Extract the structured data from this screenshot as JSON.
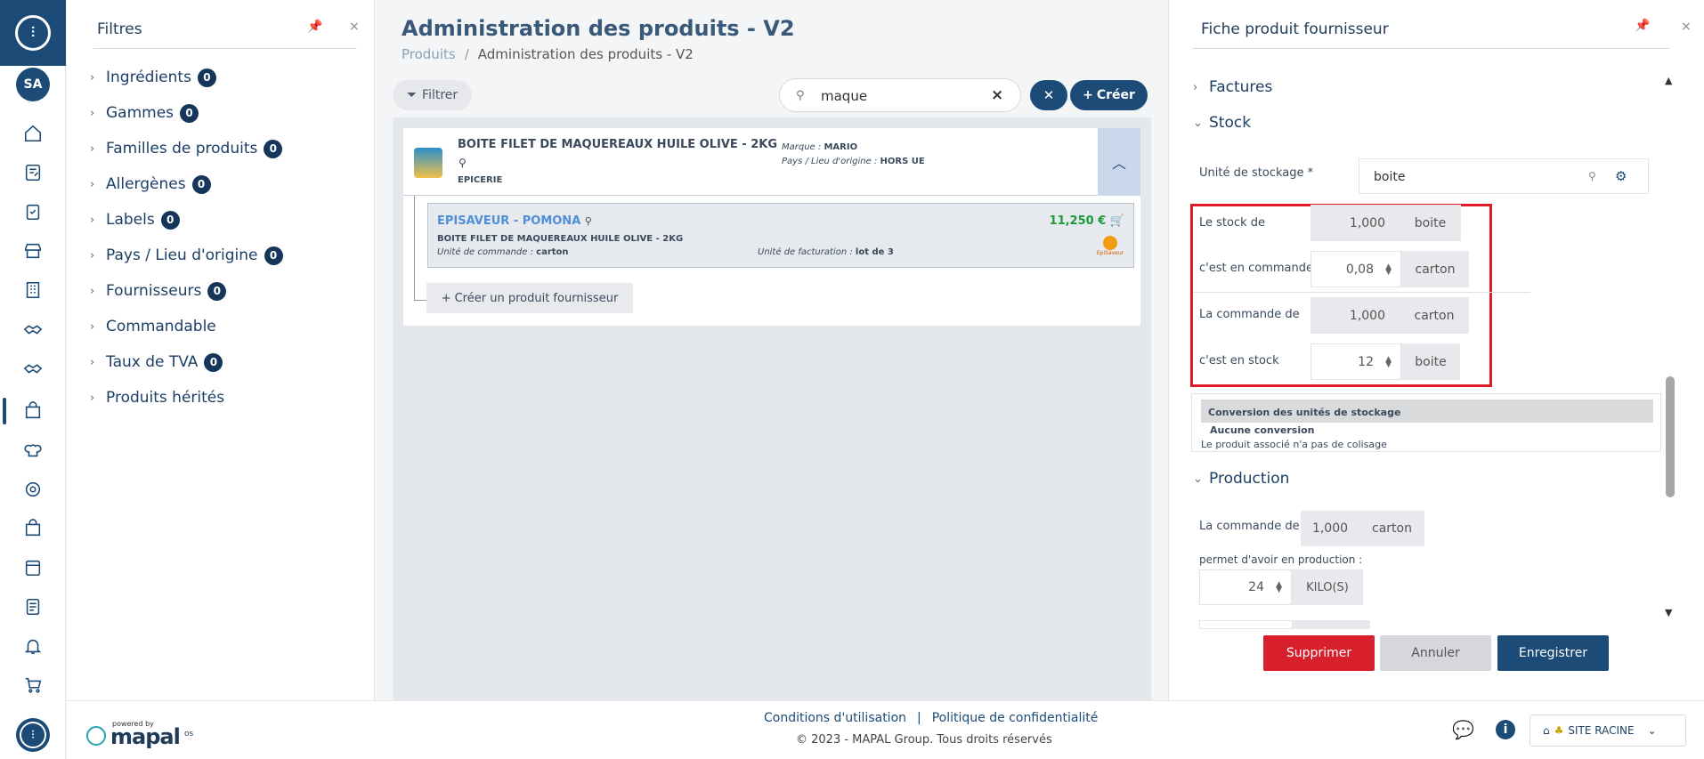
{
  "rail": {
    "avatar": "SA"
  },
  "filters": {
    "title": "Filtres",
    "items": [
      {
        "label": "Ingrédients",
        "count": "0"
      },
      {
        "label": "Gammes",
        "count": "0"
      },
      {
        "label": "Familles de produits",
        "count": "0"
      },
      {
        "label": "Allergènes",
        "count": "0"
      },
      {
        "label": "Labels",
        "count": "0"
      },
      {
        "label": "Pays / Lieu d'origine",
        "count": "0"
      },
      {
        "label": "Fournisseurs",
        "count": "0"
      },
      {
        "label": "Commandable",
        "count": ""
      },
      {
        "label": "Taux de TVA",
        "count": "0"
      },
      {
        "label": "Produits hérités",
        "count": ""
      }
    ]
  },
  "main": {
    "title": "Administration des produits - V2",
    "breadcrumb": [
      "Produits",
      "Administration des produits - V2"
    ],
    "filter_label": "Filtrer",
    "search_value": "maque",
    "create_label": "Créer",
    "product": {
      "name": "BOITE FILET DE MAQUEREAUX HUILE OLIVE - 2KG",
      "category": "EPICERIE",
      "brand_label": "Marque :",
      "brand": "MARIO",
      "origin_label": "Pays / Lieu d'origine :",
      "origin": "HORS UE"
    },
    "supplier": {
      "name": "EPISAVEUR - POMONA",
      "product": "BOITE FILET DE MAQUEREAUX HUILE OLIVE - 2KG",
      "order_unit_label": "Unité de commande :",
      "order_unit": "carton",
      "billing_unit_label": "Unité de facturation :",
      "billing_unit": "lot de 3",
      "price": "11,250 €",
      "logo_text": "EpiSaveur"
    },
    "add_supplier_label": "Créer un produit fournisseur"
  },
  "panel": {
    "title": "Fiche produit fournisseur",
    "section_invoices": "Factures",
    "section_stock": "Stock",
    "storage_unit_label": "Unité de stockage *",
    "storage_unit_value": "boite",
    "stock_rows": [
      {
        "label": "Le stock de",
        "value": "1,000",
        "unit": "boite"
      },
      {
        "label": "c'est en commande",
        "value": "0,08",
        "unit": "carton"
      },
      {
        "label": "La commande de",
        "value": "1,000",
        "unit": "carton"
      },
      {
        "label": "c'est en stock",
        "value": "12",
        "unit": "boite"
      }
    ],
    "conversion_title": "Conversion des unités de stockage",
    "conversion_none": "Aucune conversion",
    "conversion_desc": "Le produit associé n'a pas de colisage",
    "section_production": "Production",
    "prod_order_label": "La commande de :",
    "prod_order_value": "1,000",
    "prod_order_unit": "carton",
    "prod_allows_label": "permet d'avoir en production :",
    "prod_value": "24",
    "prod_unit": "KILO(S)",
    "delete_label": "Supprimer",
    "cancel_label": "Annuler",
    "save_label": "Enregistrer",
    "colors": {
      "delete": "#d8202d",
      "save": "#1b4b76",
      "highlight": "#e01c2c"
    }
  },
  "footer": {
    "powered": "powered by",
    "brand": "mapal",
    "brand_suffix": "os",
    "terms": "Conditions d'utilisation",
    "separator": "|",
    "privacy": "Politique de confidentialité",
    "copyright": "© 2023 - MAPAL Group. Tous droits réservés",
    "site": "SITE RACINE"
  }
}
